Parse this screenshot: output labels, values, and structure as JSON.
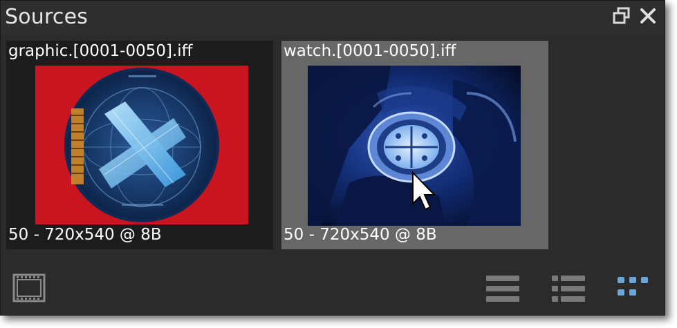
{
  "panel": {
    "title": "Sources",
    "float_icon": "float-window-icon",
    "close_icon": "close-icon"
  },
  "sources": [
    {
      "name": "graphic.[0001-0050].iff",
      "info": "50 - 720x540 @ 8B",
      "selected": false,
      "thumbnail_description": "red background with blue circular graphic and glowing X"
    },
    {
      "name": "watch.[0001-0050].iff",
      "info": "50 - 720x540 @ 8B",
      "selected": true,
      "thumbnail_description": "blue-tinted gloved hand holding a watch"
    }
  ],
  "footer": {
    "filmstrip_icon": "filmstrip-icon",
    "view_modes": [
      "list-view-icon",
      "detail-list-view-icon",
      "grid-view-icon"
    ],
    "active_view": "grid-view-icon"
  },
  "colors": {
    "panel_bg": "#2b2b2b",
    "selected_bg": "#676767",
    "unselected_bg": "#1c1c1c",
    "text": "#ffffff",
    "icon_inactive": "#7a7a7a",
    "icon_active": "#6aa6d8"
  }
}
